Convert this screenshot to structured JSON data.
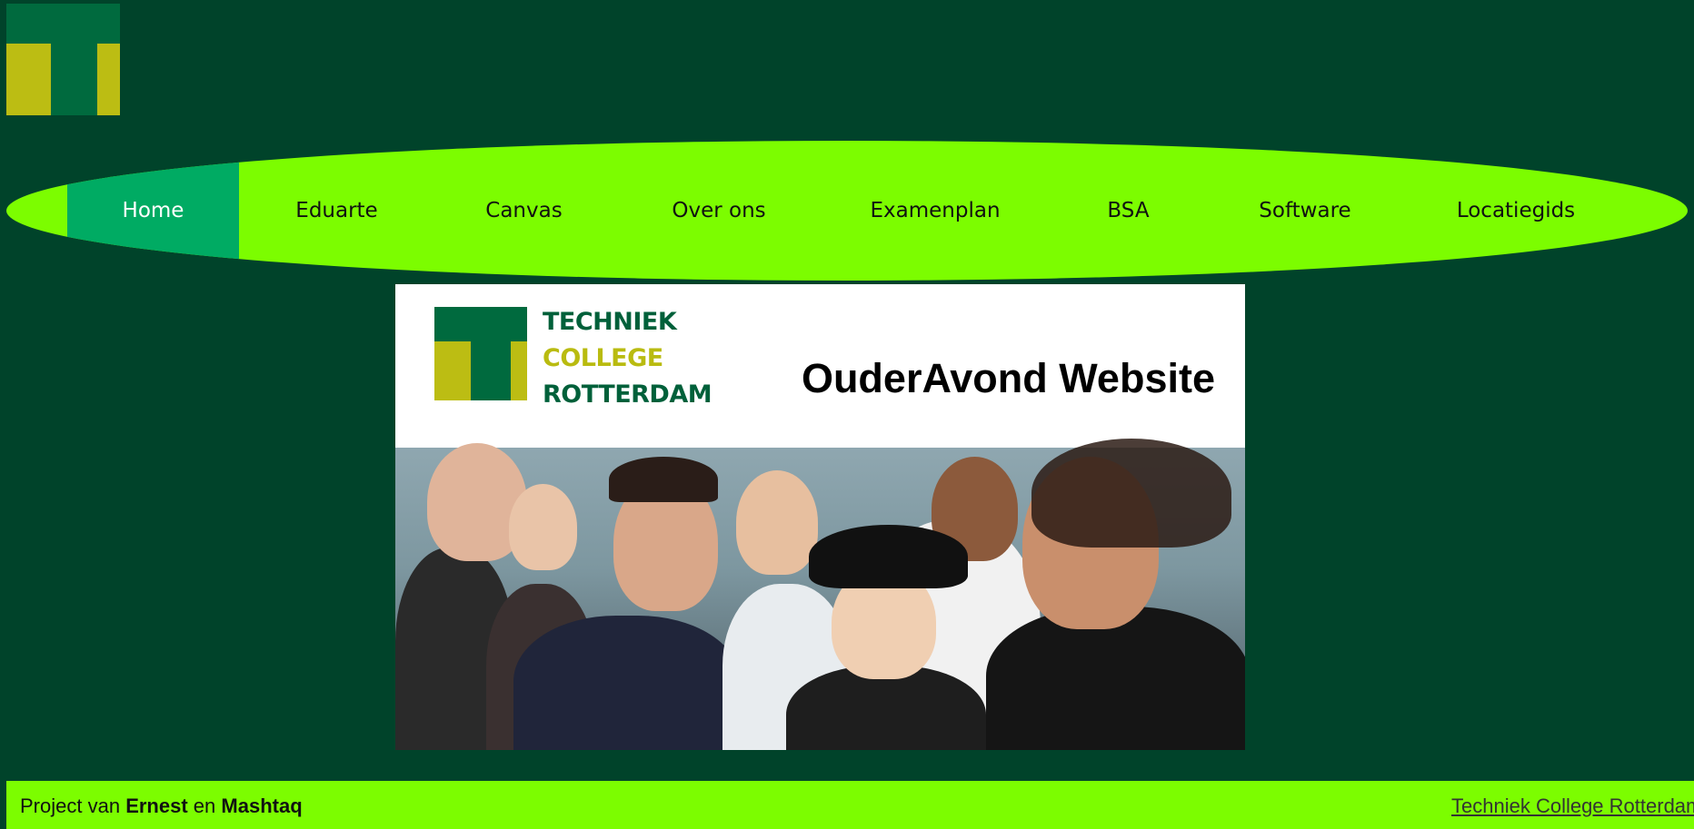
{
  "nav": {
    "items": [
      {
        "label": "Home",
        "active": true
      },
      {
        "label": "Eduarte"
      },
      {
        "label": "Canvas"
      },
      {
        "label": "Over ons"
      },
      {
        "label": "Examenplan"
      },
      {
        "label": "BSA"
      },
      {
        "label": "Software"
      },
      {
        "label": "Locatiegids"
      }
    ]
  },
  "banner": {
    "logo_lines": [
      "TECHNIEK",
      "COLLEGE",
      "ROTTERDAM"
    ],
    "title": "OuderAvond Website"
  },
  "footer": {
    "prefix": "Project van",
    "name1": "Ernest",
    "joiner": "en",
    "name2": "Mashtaq",
    "link": "Techniek College Rotterdam"
  },
  "colors": {
    "background": "#00432a",
    "nav_bg": "#7cfd00",
    "nav_active": "#00ab63",
    "brand_green": "#006a3e",
    "brand_yellow": "#bcbd13"
  }
}
